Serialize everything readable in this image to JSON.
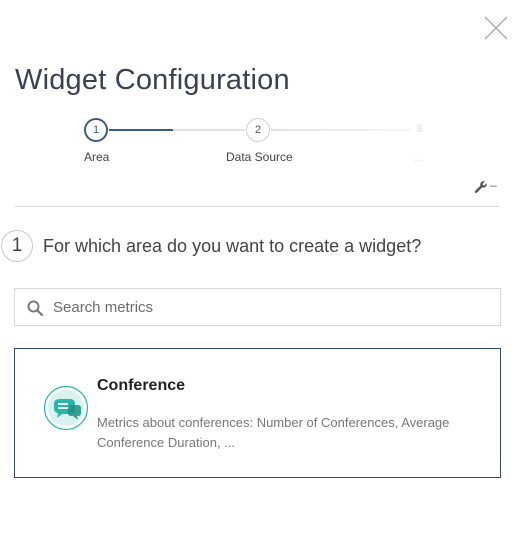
{
  "dialog": {
    "title": "Widget Configuration",
    "close_icon": "close-icon"
  },
  "stepper": {
    "steps": [
      {
        "number": "1",
        "label": "Area",
        "state": "active"
      },
      {
        "number": "2",
        "label": "Data Source",
        "state": "upcoming"
      },
      {
        "number": "3",
        "label": "...",
        "state": "faded"
      }
    ],
    "progress_color": "#3d5a80"
  },
  "toolbar": {
    "wrench_icon": "wrench-icon",
    "wrench_suffix": "–"
  },
  "question": {
    "number": "1",
    "text": "For which area do you want to create a widget?"
  },
  "search": {
    "placeholder": "Search metrics",
    "value": "",
    "icon": "search-icon"
  },
  "areas": [
    {
      "title": "Conference",
      "description": "Metrics about conferences: Number of Conferences, Average Conference Duration, ...",
      "icon": "conference-icon",
      "accent": "#2bb5a8"
    }
  ]
}
